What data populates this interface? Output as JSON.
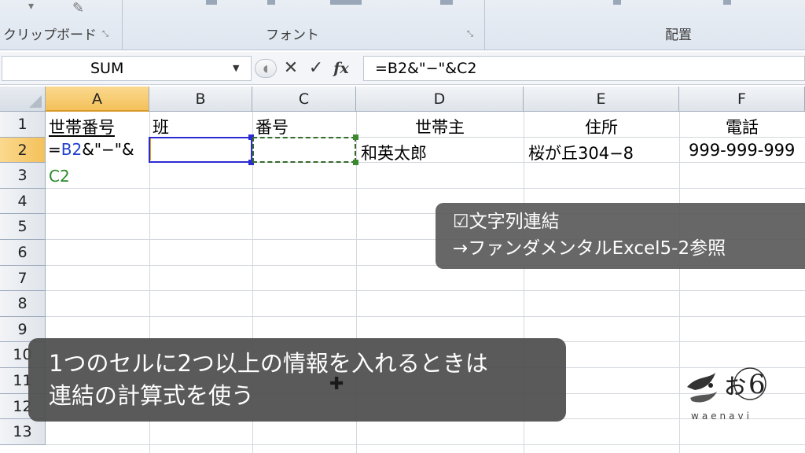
{
  "ribbon": {
    "groups": [
      {
        "label": "クリップボード"
      },
      {
        "label": "フォント"
      },
      {
        "label": "配置"
      }
    ],
    "launcher_glyph": "⤡"
  },
  "formula_bar": {
    "name_box": "SUM",
    "dropdown_glyph": "▼",
    "cancel_glyph": "✕",
    "enter_glyph": "✓",
    "fx_label": "fx",
    "formula": "=B2&\"−\"&C2"
  },
  "columns": [
    "A",
    "B",
    "C",
    "D",
    "E",
    "F"
  ],
  "rows": [
    "1",
    "2",
    "3",
    "4",
    "5",
    "6",
    "7",
    "8",
    "9",
    "10",
    "11",
    "12",
    "13"
  ],
  "cells": {
    "A1": "世帯番号",
    "B1": "班",
    "C1": "番号",
    "D1": "世帯主",
    "E1": "住所",
    "F1": "電話",
    "A2_formula_parts": [
      "=",
      "B2",
      "&\"−\"&"
    ],
    "A3": "C2",
    "D2": "和英太郎",
    "E2": "桜が丘304−8",
    "F2": "999-999-999"
  },
  "note": {
    "line1": "☑文字列連結",
    "line2": "→ファンダメンタルExcel5-2参照"
  },
  "caption": {
    "line1": "1つのセルに2つ以上の情報を入れるときは",
    "line2": "連結の計算式を使う"
  },
  "logo": {
    "text": "waenavi"
  },
  "colors": {
    "selected_header": "#f4c15a",
    "ref_b": "#2b2bd1",
    "ref_c": "#3b8a2f",
    "overlay": "#5a5a5a"
  }
}
